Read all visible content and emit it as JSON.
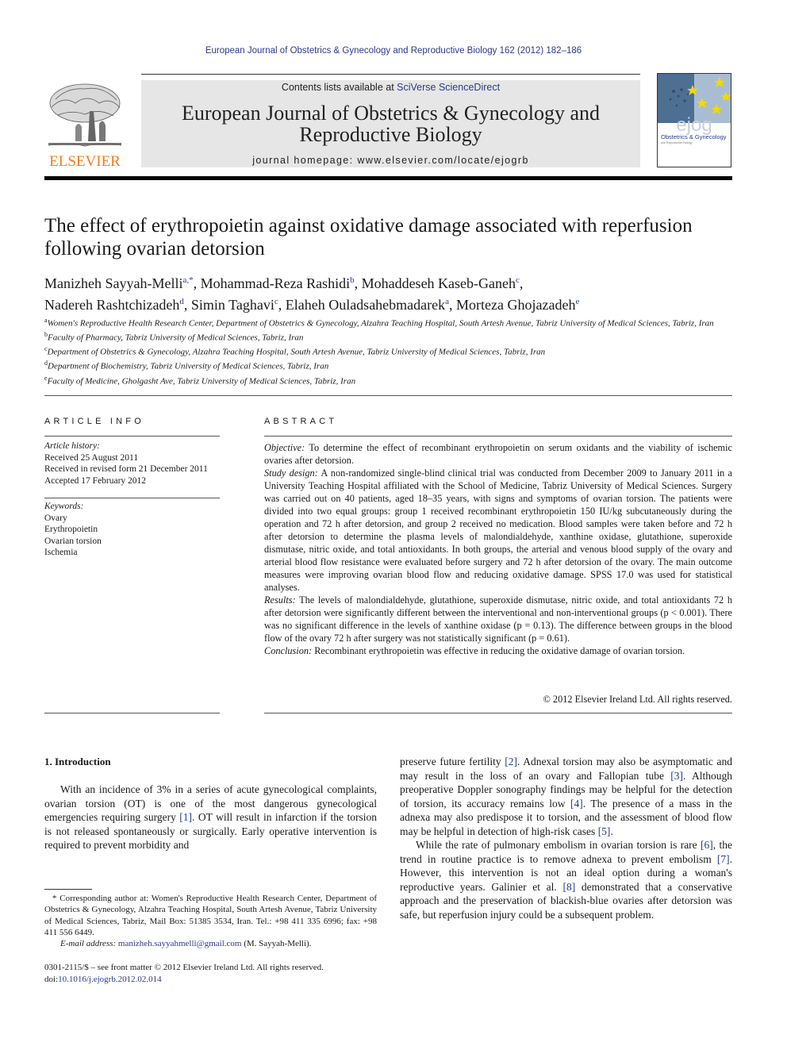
{
  "citation_header": "European Journal of Obstetrics & Gynecology and Reproductive Biology 162 (2012) 182–186",
  "masthead": {
    "contents_prefix": "Contents lists available at ",
    "contents_link": "SciVerse ScienceDirect",
    "journal_title_line1": "European Journal of Obstetrics & Gynecology and",
    "journal_title_line2": "Reproductive Biology",
    "homepage_prefix": "journal homepage: ",
    "homepage_url": "www.elsevier.com/locate/ejogrb",
    "publisher_logo_text": "ELSEVIER",
    "publisher_color": "#f07c1f",
    "cover": {
      "logo_text": "ejog",
      "subtitle": "Obstetrics & Gynecology",
      "tagline": "and Reproductive Biology"
    }
  },
  "article": {
    "title_line1": "The effect of erythropoietin against oxidative damage associated with reperfusion",
    "title_line2": "following ovarian detorsion",
    "authors": [
      {
        "name": "Manizheh Sayyah-Melli",
        "sup": "a,*",
        "sep": ", "
      },
      {
        "name": "Mohammad-Reza Rashidi",
        "sup": "b",
        "sep": ", "
      },
      {
        "name": "Mohaddeseh Kaseb-Ganeh",
        "sup": "c",
        "sep": ","
      },
      {
        "name": "Nadereh Rashtchizadeh",
        "sup": "d",
        "sep": ", "
      },
      {
        "name": "Simin Taghavi",
        "sup": "c",
        "sep": ", "
      },
      {
        "name": "Elaheh Ouladsahebmadarek",
        "sup": "a",
        "sep": ", "
      },
      {
        "name": "Morteza Ghojazadeh",
        "sup": "e",
        "sep": ""
      }
    ],
    "affiliations": [
      {
        "key": "a",
        "text": "Women's Reproductive Health Research Center, Department of Obstetrics & Gynecology, Alzahra Teaching Hospital, South Artesh Avenue, Tabriz University of Medical Sciences, Tabriz, Iran"
      },
      {
        "key": "b",
        "text": "Faculty of Pharmacy, Tabriz University of Medical Sciences, Tabriz, Iran"
      },
      {
        "key": "c",
        "text": "Department of Obstetrics & Gynecology, Alzahra Teaching Hospital, South Artesh Avenue, Tabriz University of Medical Sciences, Tabriz, Iran"
      },
      {
        "key": "d",
        "text": "Department of Biochemistry, Tabriz University of Medical Sciences, Tabriz, Iran"
      },
      {
        "key": "e",
        "text": "Faculty of Medicine, Gholgasht Ave, Tabriz University of Medical Sciences, Tabriz, Iran"
      }
    ]
  },
  "article_info": {
    "heading": "ARTICLE INFO",
    "history_label": "Article history:",
    "history": [
      "Received 25 August 2011",
      "Received in revised form 21 December 2011",
      "Accepted 17 February 2012"
    ],
    "keywords_label": "Keywords:",
    "keywords": [
      "Ovary",
      "Erythropoietin",
      "Ovarian torsion",
      "Ischemia"
    ]
  },
  "abstract": {
    "heading": "ABSTRACT",
    "sections": [
      {
        "label": "Objective:",
        "text": " To determine the effect of recombinant erythropoietin on serum oxidants and the viability of ischemic ovaries after detorsion."
      },
      {
        "label": "Study design:",
        "text": " A non-randomized single-blind clinical trial was conducted from December 2009 to January 2011 in a University Teaching Hospital affiliated with the School of Medicine, Tabriz University of Medical Sciences. Surgery was carried out on 40 patients, aged 18–35 years, with signs and symptoms of ovarian torsion. The patients were divided into two equal groups: group 1 received recombinant erythropoietin 150 IU/kg subcutaneously during the operation and 72 h after detorsion, and group 2 received no medication. Blood samples were taken before and 72 h after detorsion to determine the plasma levels of malondialdehyde, xanthine oxidase, glutathione, superoxide dismutase, nitric oxide, and total antioxidants. In both groups, the arterial and venous blood supply of the ovary and arterial blood flow resistance were evaluated before surgery and 72 h after detorsion of the ovary. The main outcome measures were improving ovarian blood flow and reducing oxidative damage. SPSS 17.0 was used for statistical analyses."
      },
      {
        "label": "Results:",
        "text": " The levels of malondialdehyde, glutathione, superoxide dismutase, nitric oxide, and total antioxidants 72 h after detorsion were significantly different between the interventional and non-interventional groups (p < 0.001). There was no significant difference in the levels of xanthine oxidase (p = 0.13). The difference between groups in the blood flow of the ovary 72 h after surgery was not statistically significant (p = 0.61)."
      },
      {
        "label": "Conclusion:",
        "text": " Recombinant erythropoietin was effective in reducing the oxidative damage of ovarian torsion."
      }
    ],
    "copyright": "© 2012 Elsevier Ireland Ltd. All rights reserved."
  },
  "introduction": {
    "heading": "1.  Introduction",
    "left_para": [
      {
        "t": "With an incidence of 3% in a series of acute gynecological complaints, ovarian torsion (OT) is one of the most dangerous gynecological emergencies requiring surgery "
      },
      {
        "ref": "[1]"
      },
      {
        "t": ". OT will result in infarction if the torsion is not released spontaneously or surgically. Early operative intervention is required to prevent morbidity and"
      }
    ],
    "right_para1": [
      {
        "t": "preserve future fertility "
      },
      {
        "ref": "[2]"
      },
      {
        "t": ". Adnexal torsion may also be asymptomatic and may result in the loss of an ovary and Fallopian tube "
      },
      {
        "ref": "[3]"
      },
      {
        "t": ". Although preoperative Doppler sonography findings may be helpful for the detection of torsion, its accuracy remains low "
      },
      {
        "ref": "[4]"
      },
      {
        "t": ". The presence of a mass in the adnexa may also predispose it to torsion, and the assessment of blood flow may be helpful in detection of high-risk cases "
      },
      {
        "ref": "[5]"
      },
      {
        "t": "."
      }
    ],
    "right_para2": [
      {
        "t": "While the rate of pulmonary embolism in ovarian torsion is rare "
      },
      {
        "ref": "[6]"
      },
      {
        "t": ", the trend in routine practice is to remove adnexa to prevent embolism "
      },
      {
        "ref": "[7]"
      },
      {
        "t": ". However, this intervention is not an ideal option during a woman's reproductive years. Galinier et al. "
      },
      {
        "ref": "[8]"
      },
      {
        "t": " demonstrated that a conservative approach and the preservation of blackish-blue ovaries after detorsion was safe, but reperfusion injury could be a subsequent problem."
      }
    ]
  },
  "footnote": {
    "corresponding": "* Corresponding author at: Women's Reproductive Health Research Center, Department of Obstetrics & Gynecology, Alzahra Teaching Hospital, South Artesh Avenue, Tabriz University of Medical Sciences, Tabriz, Mail Box: 51385 3534, Iran. Tel.: +98 411 335 6996; fax: +98 411 556 6449.",
    "email_label": "E-mail address:",
    "email": "manizheh.sayyahmelli@gmail.com",
    "email_suffix": " (M. Sayyah-Melli)."
  },
  "front_matter": {
    "line1": "0301-2115/$ – see front matter © 2012 Elsevier Ireland Ltd. All rights reserved.",
    "doi_prefix": "doi:",
    "doi": "10.1016/j.ejogrb.2012.02.014"
  }
}
